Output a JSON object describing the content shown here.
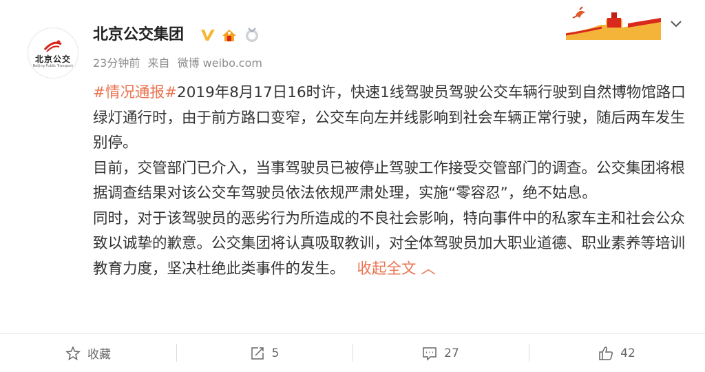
{
  "author": {
    "name": "北京公交集团",
    "avatar_brand": "北京公交",
    "avatar_sub": "Beijing Public Transport"
  },
  "meta": {
    "time": "23分钟前",
    "from": "来自",
    "source": "微博 weibo.com"
  },
  "content": {
    "p1_topic": "#情况通报#",
    "p1_text": "2019年8月17日16时许，快速1线驾驶员驾驶公交车辆行驶到自然博物馆路口绿灯通行时，由于前方路口变窄，公交车向左并线影响到社会车辆正常行驶，随后两车发生别停。",
    "p2": "目前，交管部门已介入，当事驾驶员已被停止驾驶工作接受交管部门的调查。公交集团将根据调查结果对该公交车驾驶员依法依规严肃处理，实施“零容忍”，绝不姑息。",
    "p3": "同时，对于该驾驶员的恶劣行为所造成的不良社会影响，特向事件中的私家车主和社会公众致以诚挚的歉意。公交集团将认真吸取教训，对全体驾驶员加大职业道德、职业素养等培训教育力度，坚决杜绝此类事件的发生。",
    "collapse": "收起全文 ︿"
  },
  "footer": {
    "favorite": "收藏",
    "repost": "5",
    "comment": "27",
    "like": "42"
  },
  "colors": {
    "accent": "#eb7350",
    "verified": "#f6b632"
  },
  "icons": [
    "logo-icon",
    "verified-icon",
    "member-badge-icon",
    "medal-icon",
    "great-wall-decoration",
    "chevron-down-icon",
    "star-icon",
    "repost-icon",
    "comment-icon",
    "like-icon"
  ]
}
